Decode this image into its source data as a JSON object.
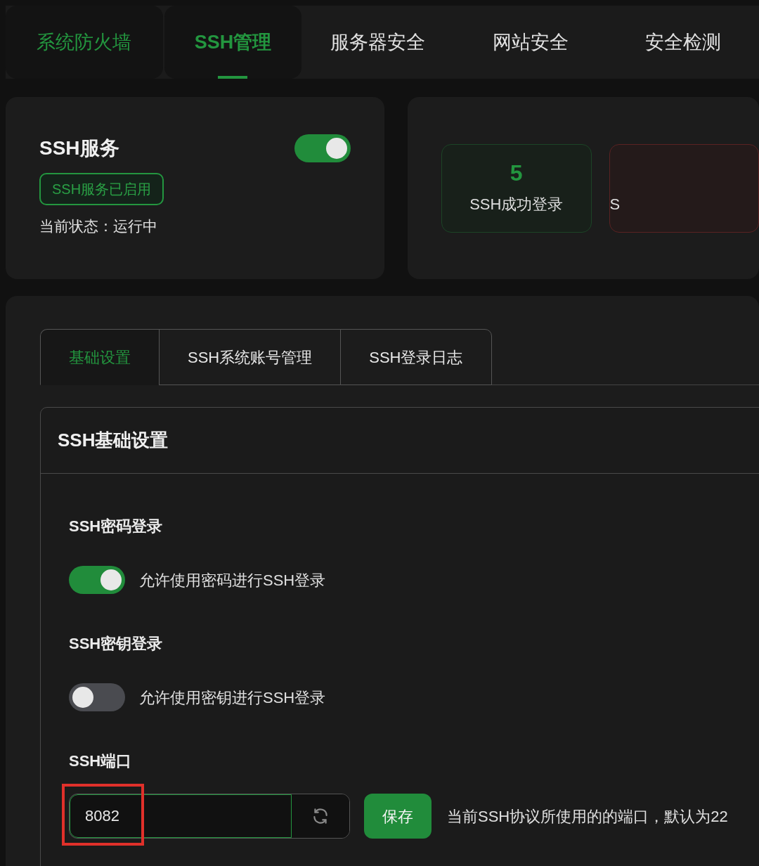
{
  "top_tabs": [
    {
      "label": "系统防火墙",
      "selected": false,
      "hovered": true
    },
    {
      "label": "SSH管理",
      "selected": true,
      "hovered": true
    },
    {
      "label": "服务器安全",
      "selected": false,
      "hovered": false
    },
    {
      "label": "网站安全",
      "selected": false,
      "hovered": false
    },
    {
      "label": "安全检测",
      "selected": false,
      "hovered": false
    }
  ],
  "service_card": {
    "title": "SSH服务",
    "on": true,
    "badge": "SSH服务已启用",
    "status": "当前状态：运行中"
  },
  "stats": [
    {
      "value": "5",
      "label": "SSH成功登录",
      "color": "#1c4426"
    },
    {
      "label": "S",
      "color": "#5a2222"
    }
  ],
  "sub_tabs": [
    {
      "label": "基础设置",
      "selected": true
    },
    {
      "label": "SSH系统账号管理",
      "selected": false
    },
    {
      "label": "SSH登录日志",
      "selected": false
    }
  ],
  "section": {
    "title": "SSH基础设置",
    "settings": [
      {
        "kind": "toggle",
        "title": "SSH密码登录",
        "on": true,
        "label": "允许使用密码进行SSH登录"
      },
      {
        "kind": "toggle",
        "title": "SSH密钥登录",
        "on": false,
        "label": "允许使用密钥进行SSH登录"
      },
      {
        "kind": "port",
        "title": "SSH端口",
        "value": "8082",
        "highlighted": true,
        "button": "保存",
        "hint": "当前SSH协议所使用的的端口，默认为22"
      }
    ]
  }
}
